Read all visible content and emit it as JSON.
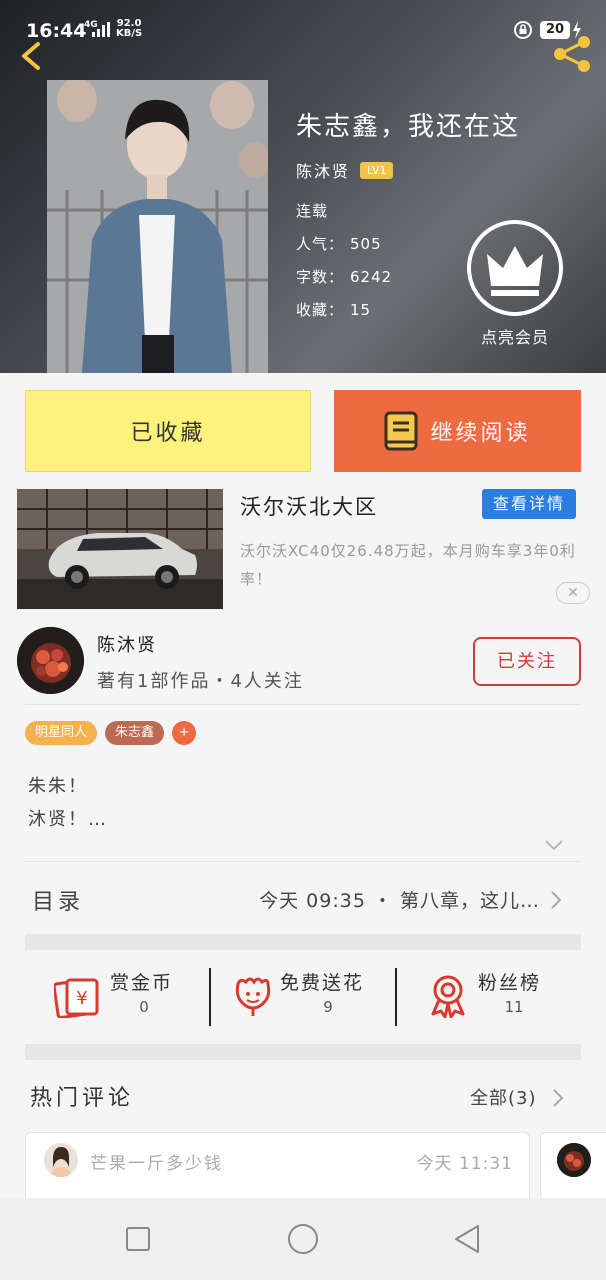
{
  "status_bar": {
    "time": "16:44",
    "network": "4G",
    "speed_value": "92.0",
    "speed_unit": "KB/S",
    "battery": "20"
  },
  "book": {
    "title": "朱志鑫，我还在这",
    "author": "陈沐贤",
    "level": "LV1",
    "status": "连载",
    "popularity_label": "人气：",
    "popularity": "505",
    "word_count_label": "字数：",
    "word_count": "6242",
    "collect_label": "收藏：",
    "collect_count": "15"
  },
  "vip": {
    "label": "点亮会员"
  },
  "actions": {
    "favorite_label": "已收藏",
    "read_label": "继续阅读"
  },
  "ad": {
    "title": "沃尔沃北大区",
    "button": "查看详情",
    "description": "沃尔沃XC40仅26.48万起，本月购车享3年0利率！",
    "close": "✕"
  },
  "author_card": {
    "name": "陈沐贤",
    "stats": "著有1部作品・4人关注",
    "follow": "已关注"
  },
  "tags": [
    "明星同人",
    "朱志鑫",
    "+"
  ],
  "intro": {
    "line1": "朱朱！",
    "line2": "沐贤！…"
  },
  "toc": {
    "label": "目录",
    "latest": "今天 09:35 ・ 第八章，这儿…"
  },
  "stats": {
    "reward_label": "赏金币",
    "reward_value": "0",
    "flower_label": "免费送花",
    "flower_value": "9",
    "fans_label": "粉丝榜",
    "fans_value": "11"
  },
  "comments": {
    "title": "热门评论",
    "all": "全部(3)",
    "items": [
      {
        "user": "芒果一斤多少钱",
        "time": "今天 11:31"
      }
    ]
  },
  "colors": {
    "accent_orange": "#ee6a40",
    "fav_yellow": "#fdf27e",
    "follow_red": "#d23b3b",
    "ad_blue": "#2b7de1",
    "badge_gold": "#f0c44c"
  }
}
